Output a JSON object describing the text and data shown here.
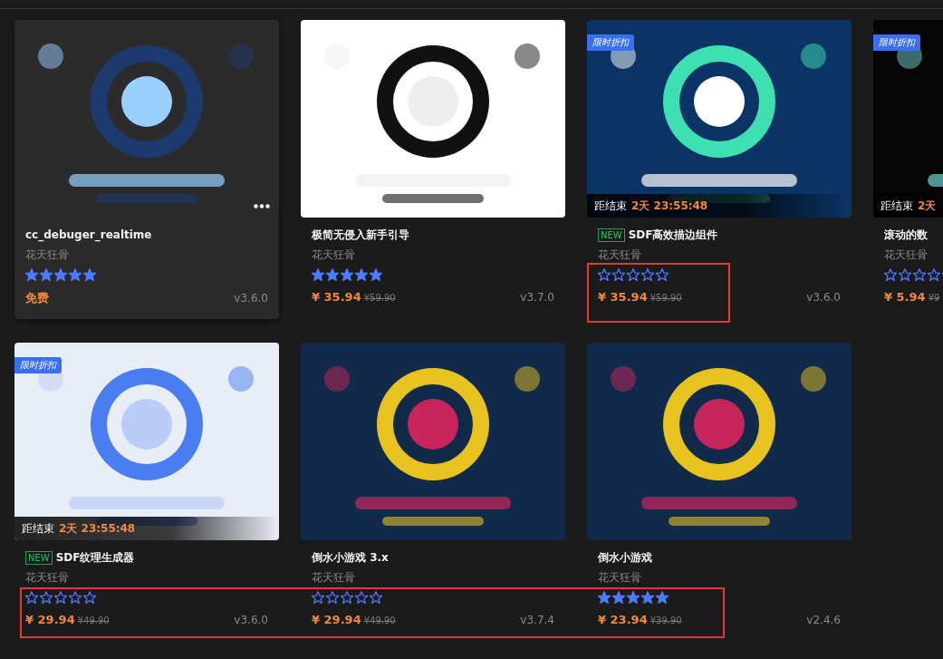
{
  "rows": [
    {
      "highlighted": false,
      "cards": [
        {
          "hovered": true,
          "is_new": false,
          "title": "cc_debuger_realtime",
          "author": "花天狂骨",
          "stars": 5,
          "kind": "free",
          "price": "免费",
          "version": "v3.6.0",
          "highlighted": false
        },
        {
          "hovered": false,
          "is_new": false,
          "title": "极简无侵入新手引导",
          "author": "花天狂骨",
          "stars": 5,
          "kind": "paid",
          "price": "¥ 35.94",
          "original_price": "¥59.90",
          "version": "v3.7.0",
          "highlighted": false
        },
        {
          "hovered": false,
          "discount_badge": "限时折扣",
          "countdown": {
            "label": "距结束",
            "time": "2天 23:55:48"
          },
          "is_new": true,
          "new_tag": "NEW",
          "title": "SDF高效描边组件",
          "author": "花天狂骨",
          "stars": 0,
          "kind": "paid",
          "price": "¥ 35.94",
          "original_price": "¥59.90",
          "version": "v3.6.0",
          "highlighted": true
        },
        {
          "hovered": false,
          "discount_badge": "限时折扣",
          "countdown": {
            "label": "距结束",
            "time": "2天"
          },
          "is_new": false,
          "title": "滚动的数",
          "author": "花天狂骨",
          "stars": 0,
          "kind": "paid",
          "price": "¥ 5.94",
          "original_price": "¥9",
          "highlighted": false
        }
      ]
    },
    {
      "highlighted": true,
      "cards": [
        {
          "hovered": false,
          "discount_badge": "限时折扣",
          "countdown": {
            "label": "距结束",
            "time": "2天 23:55:48"
          },
          "is_new": true,
          "new_tag": "NEW",
          "title": "SDF纹理生成器",
          "author": "花天狂骨",
          "stars": 0,
          "kind": "paid",
          "price": "¥ 29.94",
          "original_price": "¥49.90",
          "version": "v3.6.0",
          "highlighted": false
        },
        {
          "hovered": false,
          "is_new": false,
          "title": "倒水小游戏 3.x",
          "author": "花天狂骨",
          "stars": 0,
          "kind": "paid",
          "price": "¥ 29.94",
          "original_price": "¥49.90",
          "version": "v3.7.4",
          "highlighted": false
        },
        {
          "hovered": false,
          "is_new": false,
          "title": "倒水小游戏",
          "author": "花天狂骨",
          "stars": 5,
          "kind": "paid",
          "price": "¥ 23.94",
          "original_price": "¥39.90",
          "version": "v2.4.6",
          "highlighted": false
        }
      ]
    }
  ]
}
